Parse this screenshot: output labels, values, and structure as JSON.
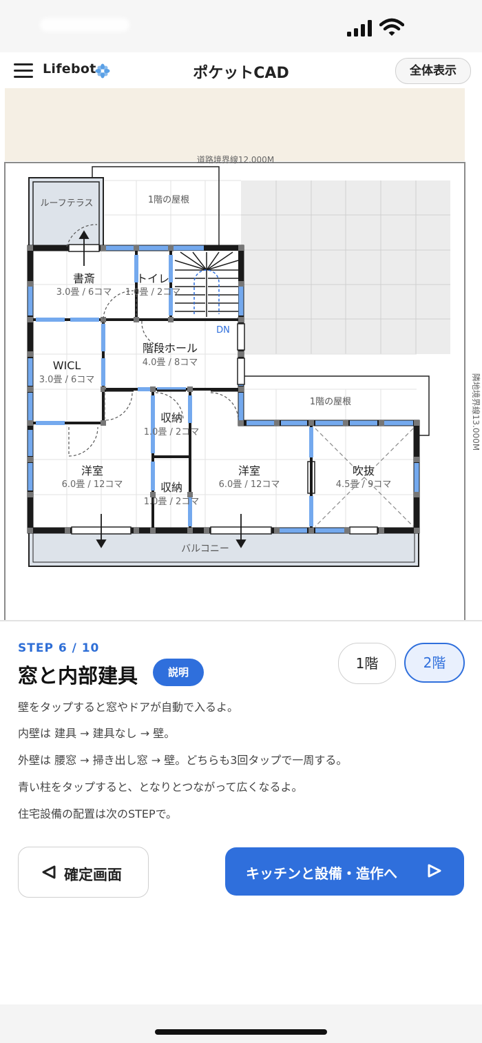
{
  "app": {
    "brand": "Lifebot",
    "title": "ポケットCAD",
    "fit_button": "全体表示"
  },
  "plan": {
    "road_boundary": "道路境界線12.000M",
    "neighbor_boundary": "隣地境界線13.000M",
    "roof_terrace": "ルーフテラス",
    "first_floor_roof_top": "1階の屋根",
    "first_floor_roof_right": "1階の屋根",
    "balcony": "バルコニー",
    "stairs_dir": "DN",
    "rooms": [
      {
        "name": "書斎",
        "size": "3.0畳 / 6コマ"
      },
      {
        "name": "トイレ",
        "size": "1.0畳 / 2コマ"
      },
      {
        "name": "階段ホール",
        "size": "4.0畳 / 8コマ"
      },
      {
        "name": "WICL",
        "size": "3.0畳 / 6コマ"
      },
      {
        "name": "収納",
        "size": "1.0畳 / 2コマ"
      },
      {
        "name": "収納",
        "size": "1.0畳 / 2コマ"
      },
      {
        "name": "洋室",
        "size": "6.0畳 / 12コマ"
      },
      {
        "name": "洋室",
        "size": "6.0畳 / 12コマ"
      },
      {
        "name": "吹抜",
        "size": "4.5畳 / 9コマ"
      }
    ]
  },
  "panel": {
    "step": "STEP 6 / 10",
    "heading": "窓と内部建具",
    "help_button": "説明",
    "floor_buttons": [
      "1階",
      "2階"
    ],
    "selected_floor": "2階",
    "lines": [
      "壁をタップすると窓やドアが自動で入るよ。",
      "内壁は 建具 → 建具なし → 壁。",
      "外壁は 腰窓 → 掃き出し窓 → 壁。どちらも3回タップで一周する。",
      "青い柱をタップすると、となりとつながって広くなるよ。",
      "住宅設備の配置は次のSTEPで。"
    ],
    "back_button": "確定画面",
    "next_button": "キッチンと設備・造作へ"
  },
  "colors": {
    "accent": "#2f6fdc",
    "wall_blue": "#74a9ee",
    "sidewalk": "#f5efe4"
  }
}
